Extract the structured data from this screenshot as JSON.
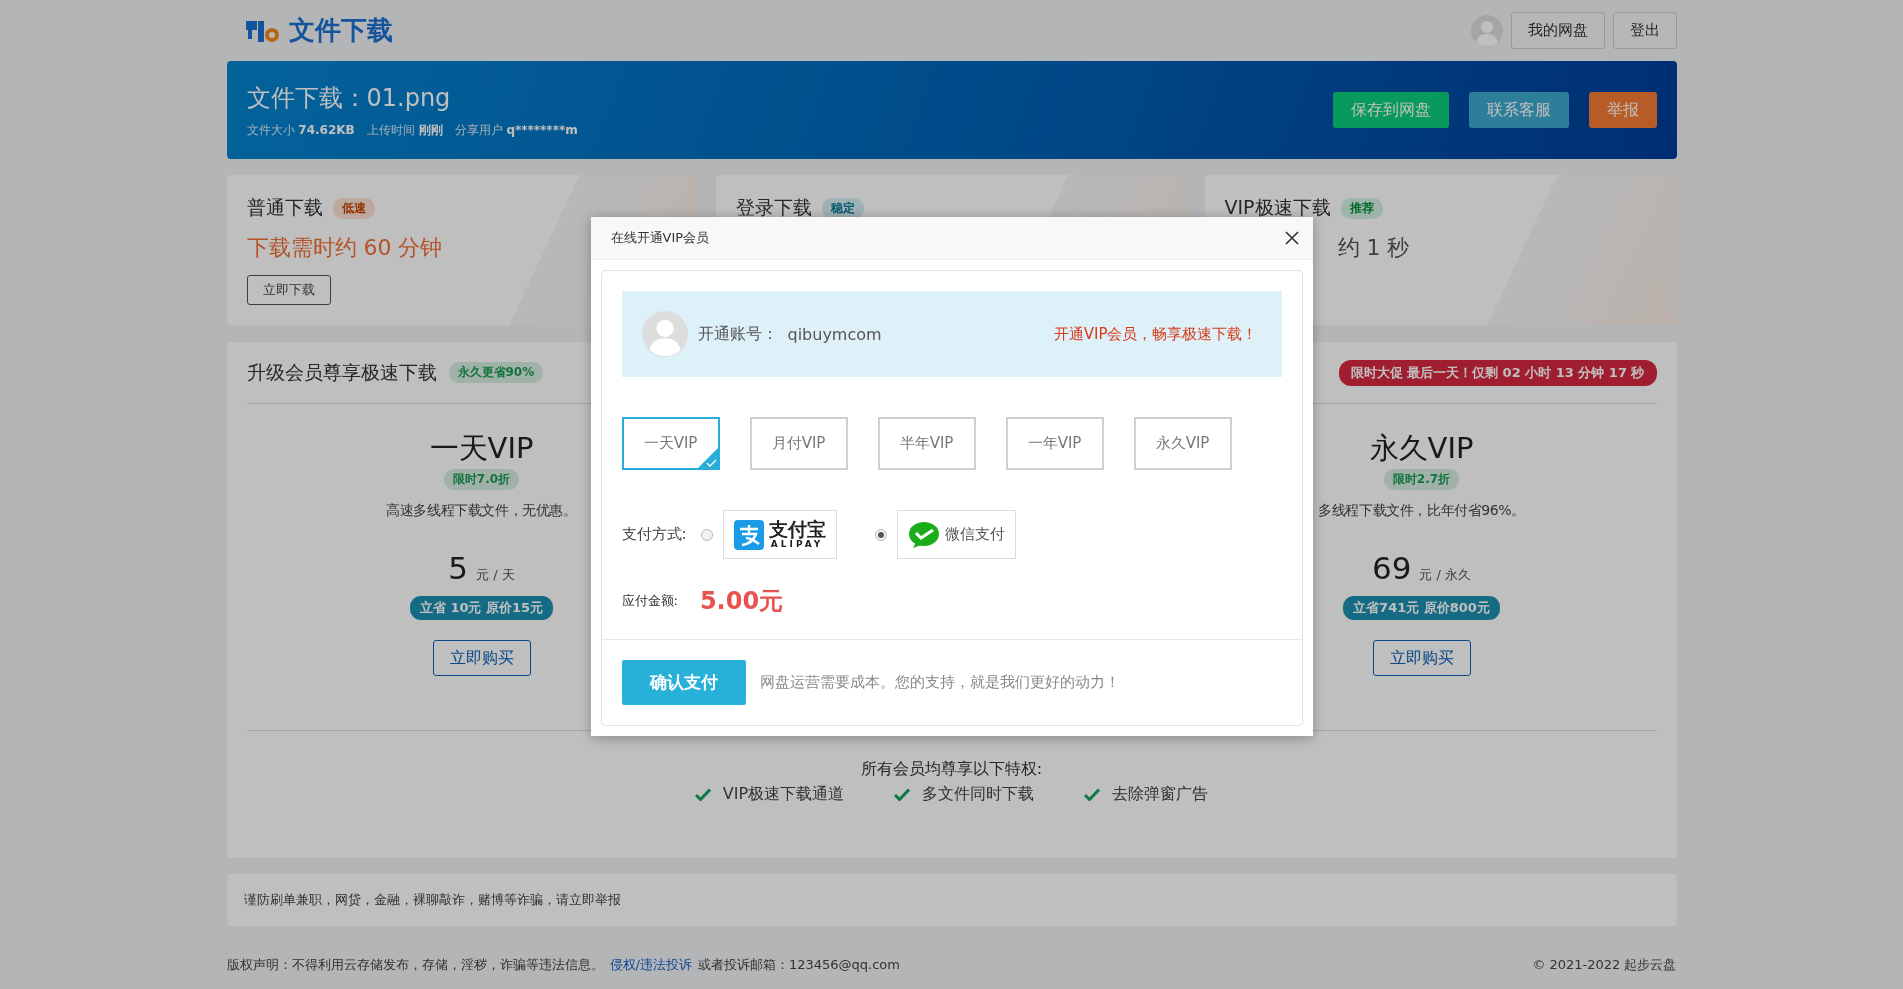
{
  "header": {
    "logo_text": "文件下载",
    "buttons": [
      "我的网盘",
      "登出"
    ]
  },
  "file": {
    "title": "文件下载：01.png",
    "meta": [
      {
        "label": "文件大小",
        "value": "74.62KB"
      },
      {
        "label": "上传时间",
        "value": "刚刚"
      },
      {
        "label": "分享用户",
        "value": "q********m"
      }
    ],
    "actions": [
      {
        "label": "保存到网盘",
        "color": "#089a5c"
      },
      {
        "label": "联系客服",
        "color": "#2e7f98"
      },
      {
        "label": "举报",
        "color": "#b85c28"
      }
    ]
  },
  "download_options": [
    {
      "title": "普通下载",
      "badge": "低速",
      "color": "#bca99c",
      "time": "下载需时约 60 分钟",
      "button": "立即下载"
    },
    {
      "title": "登录下载",
      "badge": "稳定",
      "color": "#9eb1b5"
    },
    {
      "title": "VIP极速下载",
      "badge": "推荐",
      "color": "#9fb4a8",
      "time": "约 1 秒"
    }
  ],
  "upgrade": {
    "title": "升级会员尊享极速下载",
    "badge": "永久更省90%",
    "promo": "限时大促 最后一天！仅剩 02 小时 13 分钟 17 秒",
    "plans": [
      {
        "name": "一天VIP",
        "discount": "限时7.0折",
        "desc": "高速多线程下载文件，无优惠。",
        "price": "5",
        "unit": "元 / 天",
        "saving": "立省 10元 原价15元",
        "button": "立即购买"
      },
      {
        "name": "永久VIP",
        "discount": "限时2.7折",
        "desc": "多线程下载文件，比年付省96%。",
        "price": "69",
        "unit": "元 / 永久",
        "saving": "立省741元 原价800元",
        "button": "立即购买"
      }
    ],
    "perks_title": "所有会员均尊享以下特权:",
    "perks": [
      "VIP极速下载通道",
      "多文件同时下载",
      "去除弹窗广告"
    ]
  },
  "notice": "谨防刷单兼职，网贷，金融，裸聊敲诈，赌博等诈骗，请立即举报",
  "footer": {
    "statement": "版权声明：不得利用云存储发布，存储，淫秽，诈骗等违法信息。",
    "link": "侵权/违法投诉",
    "email": "或者投诉邮箱：123456@qq.com",
    "copyright": "© 2021-2022 起步云盘"
  },
  "modal": {
    "title": "在线开通VIP会员",
    "account_label": "开通账号：",
    "account": "qibuymcom",
    "slogan": "开通VIP会员，畅享极速下载！",
    "options": [
      {
        "label": "一天VIP",
        "selected": true
      },
      {
        "label": "月付VIP",
        "selected": false
      },
      {
        "label": "半年VIP",
        "selected": false
      },
      {
        "label": "一年VIP",
        "selected": false
      },
      {
        "label": "永久VIP",
        "selected": false
      }
    ],
    "payment_label": "支付方式:",
    "methods": [
      {
        "kind": "alipay",
        "name": "支付宝",
        "sub": "ALIPAY",
        "selected": false
      },
      {
        "kind": "wechat",
        "name": "微信支付",
        "selected": true
      }
    ],
    "amount_label": "应付金额:",
    "amount": "5.00元",
    "confirm": "确认支付",
    "note": "网盘运营需要成本。您的支持，就是我们更好的动力！"
  }
}
